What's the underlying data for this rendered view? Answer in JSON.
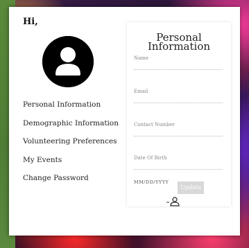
{
  "sidebar": {
    "greeting": "Hi,",
    "items": [
      {
        "label": "Personal Information"
      },
      {
        "label": "Demographic Information"
      },
      {
        "label": "Volunteering Preferences"
      },
      {
        "label": "My Events"
      },
      {
        "label": "Change Password"
      }
    ]
  },
  "form": {
    "title_line1": "Personal",
    "title_line2": "Information",
    "fields": [
      {
        "label": "Name"
      },
      {
        "label": "Email"
      },
      {
        "label": "Contact Number"
      },
      {
        "label": "Date Of Birth"
      }
    ],
    "date_hint": "MM/DD/YYYY",
    "update_label": "Update"
  },
  "icons": {
    "avatar": "user-avatar-icon",
    "small": "user-icon"
  }
}
